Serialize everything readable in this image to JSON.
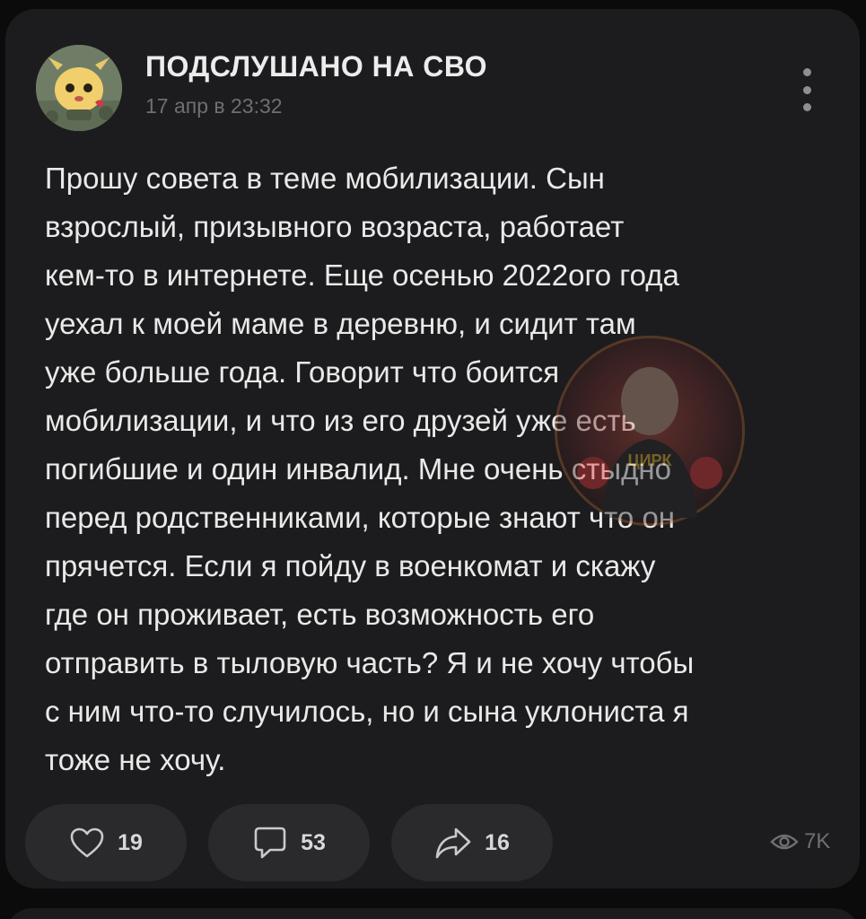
{
  "post": {
    "group_name": "ПОДСЛУШАНО НА СВО",
    "timestamp": "17 апр в 23:32",
    "text": "Прошу совета в теме мобилизации. Сын\nвзрослый, призывного возраста, работает\nкем-то в интернете. Еще осенью 2022ого года\nуехал к моей маме в деревню, и сидит там\nуже больше года. Говорит что боится\nмобилизации, и что из его друзей уже есть\nпогибшие и один инвалид. Мне очень стыдно\nперед родственниками, которые знают что он\nпрячется. Если я пойду в военкомат и скажу\nгде он проживает, есть возможность его\nотправить в тыловую часть? Я и не хочу чтобы\nс ним что-то случилось, но и сына уклониста я\nтоже не хочу.",
    "watermark_text": "ЦИРК"
  },
  "actions": {
    "likes": "19",
    "comments": "53",
    "shares": "16",
    "views": "7K"
  },
  "icons": {
    "more": "more-vertical-icon",
    "like": "heart-icon",
    "comment": "comment-icon",
    "share": "share-arrow-icon",
    "views": "eye-icon"
  },
  "colors": {
    "background": "#0b0b0c",
    "card": "#1c1c1e",
    "button": "#2a2a2d",
    "text": "#e9e9e9",
    "muted": "#6f6f73"
  }
}
